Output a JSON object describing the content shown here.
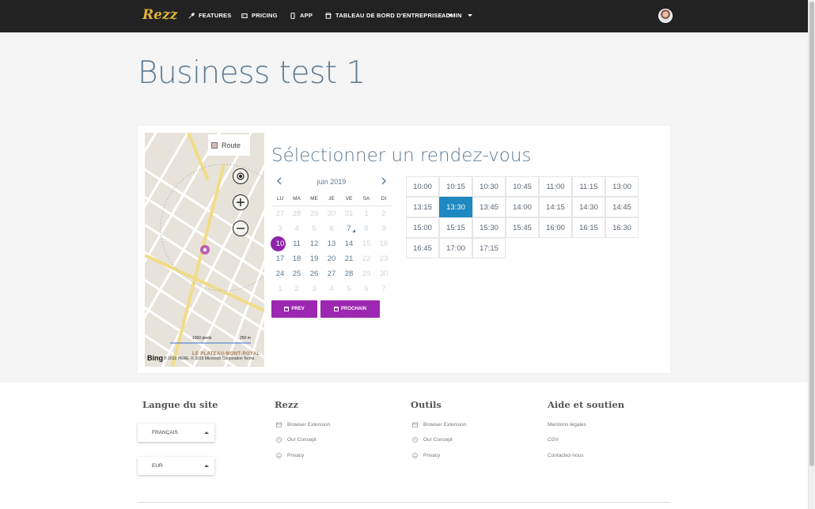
{
  "navbar": {
    "brand": "Rezz",
    "items": [
      {
        "label": "FEATURES",
        "icon": "rocket-icon"
      },
      {
        "label": "PRICING",
        "icon": "tag-icon"
      },
      {
        "label": "APP",
        "icon": "mobile-icon"
      },
      {
        "label": "TABLEAU DE BORD D'ENTREPRISE",
        "icon": "store-icon",
        "dropdown": true
      },
      {
        "label": "ADMIN",
        "dropdown": true
      }
    ]
  },
  "page": {
    "title": "Business test 1"
  },
  "map": {
    "route_label": "Route",
    "scale_feet": "1000 pieds",
    "scale_m": "250 m",
    "area_label": "LE PLATEAU-MONT-ROYAL",
    "provider": "Bing",
    "credit": "© 2019 HERE, © 2019 Microsoft Corporation Terms"
  },
  "booking": {
    "title": "Sélectionner un rendez-vous",
    "calendar": {
      "month": "juin 2019",
      "weekdays": [
        "LU",
        "MA",
        "ME",
        "JE",
        "VE",
        "SA",
        "DI"
      ],
      "weeks": [
        [
          "27",
          "28",
          "29",
          "30",
          "31",
          "1",
          "2"
        ],
        [
          "3",
          "4",
          "5",
          "6",
          "7",
          "8",
          "9"
        ],
        [
          "10",
          "11",
          "12",
          "13",
          "14",
          "15",
          "16"
        ],
        [
          "17",
          "18",
          "19",
          "20",
          "21",
          "22",
          "23"
        ],
        [
          "24",
          "25",
          "26",
          "27",
          "28",
          "29",
          "30"
        ],
        [
          "1",
          "2",
          "3",
          "4",
          "5",
          "6",
          "7"
        ]
      ],
      "selected_day": "10",
      "prev_label": "PREV",
      "next_label": "PROCHAIN"
    },
    "times": [
      [
        "10:00",
        "10:15",
        "10:30",
        "10:45",
        "11:00",
        "11:15",
        "13:00"
      ],
      [
        "13:15",
        "13:30",
        "13:45",
        "14:00",
        "14:15",
        "14:30",
        "14:45"
      ],
      [
        "15:00",
        "15:15",
        "15:30",
        "15:45",
        "16:00",
        "16:15",
        "16:30"
      ],
      [
        "16:45",
        "17:00",
        "17:15"
      ]
    ],
    "selected_time": "13:30"
  },
  "footer": {
    "language": {
      "title": "Langue du site",
      "language_value": "FRANÇAIS",
      "currency_value": "EUR"
    },
    "rezz": {
      "title": "Rezz",
      "links": [
        "Browser Extension",
        "Our Concept",
        "Privacy"
      ]
    },
    "tools": {
      "title": "Outils",
      "links": [
        "Browser Extension",
        "Our Concept",
        "Privacy"
      ]
    },
    "help": {
      "title": "Aide et soutien",
      "links": [
        "Mentions légales",
        "CGV",
        "Contactez-nous"
      ]
    }
  },
  "colors": {
    "accent_purple": "#9c27b0",
    "selected_time_blue": "#1e88c0",
    "title_blue": "#5d7a92",
    "navbar": "#222222"
  }
}
